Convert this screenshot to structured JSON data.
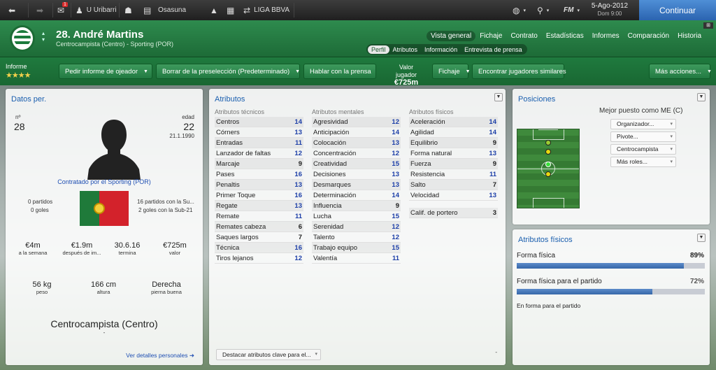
{
  "topbar": {
    "manager": "U Uribarri",
    "club": "Osasuna",
    "league": "LIGA BBVA",
    "notif_count": "1",
    "fm": "FM",
    "date": "5-Ago-2012",
    "day": "Dom 9:00",
    "continue": "Continuar"
  },
  "header": {
    "player_name": "28. André Martins",
    "player_sub": "Centrocampista (Centro) - Sporting (POR)",
    "tabs": [
      "Vista general",
      "Fichaje",
      "Contrato",
      "Estadísticas",
      "Informes",
      "Comparación",
      "Historia"
    ],
    "subtabs": [
      "Perfil",
      "Atributos",
      "Información",
      "Entrevista de prensa"
    ]
  },
  "actions": {
    "informe": "Informe",
    "stars": "★★★★",
    "scout": "Pedir informe de ojeador",
    "shortlist": "Borrar de la preselección (Predeterminado)",
    "press": "Hablar con la prensa",
    "value_label": "Valor jugador",
    "value": "€725m",
    "fichaje": "Fichaje",
    "similar": "Encontrar jugadores similares",
    "more": "Más acciones..."
  },
  "personal": {
    "title": "Datos per.",
    "num_label": "nº",
    "num": "28",
    "age_label": "edad",
    "age": "22",
    "dob": "21.1.1990",
    "contracted": "Contratado por el Sporting (POR)",
    "caps_left": "0 partidos",
    "goals_left": "0 goles",
    "caps_right": "16 partidos con la Su...",
    "goals_right": "2 goles con la Sub-21",
    "wage": "€4m",
    "wage_label": "a la semana",
    "bonus": "€1.9m",
    "bonus_label": "después de im...",
    "expiry": "30.6.16",
    "expiry_label": "termina",
    "value": "€725m",
    "value_label": "valor",
    "weight": "56 kg",
    "weight_label": "peso",
    "height": "166 cm",
    "height_label": "altura",
    "foot": "Derecha",
    "foot_label": "pierna buena",
    "position": "Centrocampista (Centro)",
    "dash": "-",
    "details_link": "Ver detalles personales ➜"
  },
  "attributes": {
    "title": "Atributos",
    "tech_header": "Atributos técnicos",
    "mental_header": "Atributos mentales",
    "phys_header": "Atributos físicos",
    "technical": [
      {
        "name": "Centros",
        "val": "14",
        "blue": true
      },
      {
        "name": "Córners",
        "val": "13",
        "blue": true
      },
      {
        "name": "Entradas",
        "val": "11",
        "blue": true
      },
      {
        "name": "Lanzador de faltas",
        "val": "12",
        "blue": true
      },
      {
        "name": "Marcaje",
        "val": "9",
        "blue": false
      },
      {
        "name": "Pases",
        "val": "16",
        "blue": true
      },
      {
        "name": "Penaltis",
        "val": "13",
        "blue": true
      },
      {
        "name": "Primer Toque",
        "val": "16",
        "blue": true
      },
      {
        "name": "Regate",
        "val": "13",
        "blue": true
      },
      {
        "name": "Remate",
        "val": "11",
        "blue": true
      },
      {
        "name": "Remates cabeza",
        "val": "6",
        "blue": false
      },
      {
        "name": "Saques largos",
        "val": "7",
        "blue": false
      },
      {
        "name": "Técnica",
        "val": "16",
        "blue": true
      },
      {
        "name": "Tiros lejanos",
        "val": "12",
        "blue": true
      }
    ],
    "mental": [
      {
        "name": "Agresividad",
        "val": "12",
        "blue": true
      },
      {
        "name": "Anticipación",
        "val": "14",
        "blue": true
      },
      {
        "name": "Colocación",
        "val": "13",
        "blue": true
      },
      {
        "name": "Concentración",
        "val": "12",
        "blue": true
      },
      {
        "name": "Creatividad",
        "val": "15",
        "blue": true
      },
      {
        "name": "Decisiones",
        "val": "13",
        "blue": true
      },
      {
        "name": "Desmarques",
        "val": "13",
        "blue": true
      },
      {
        "name": "Determinación",
        "val": "14",
        "blue": true
      },
      {
        "name": "Influencia",
        "val": "9",
        "blue": false
      },
      {
        "name": "Lucha",
        "val": "15",
        "blue": true
      },
      {
        "name": "Serenidad",
        "val": "12",
        "blue": true
      },
      {
        "name": "Talento",
        "val": "12",
        "blue": true
      },
      {
        "name": "Trabajo equipo",
        "val": "15",
        "blue": true
      },
      {
        "name": "Valentía",
        "val": "11",
        "blue": true
      }
    ],
    "physical": [
      {
        "name": "Aceleración",
        "val": "14",
        "blue": true
      },
      {
        "name": "Agilidad",
        "val": "14",
        "blue": true
      },
      {
        "name": "Equilibrio",
        "val": "9",
        "blue": false
      },
      {
        "name": "Forma natural",
        "val": "13",
        "blue": true
      },
      {
        "name": "Fuerza",
        "val": "9",
        "blue": false
      },
      {
        "name": "Resistencia",
        "val": "11",
        "blue": true
      },
      {
        "name": "Salto",
        "val": "7",
        "blue": false
      },
      {
        "name": "Velocidad",
        "val": "13",
        "blue": true
      }
    ],
    "goalkeeping": {
      "name": "Calif. de portero",
      "val": "3"
    },
    "highlight_button": "Destacar atributos clave para el...",
    "dash": "-"
  },
  "positions": {
    "title": "Posiciones",
    "best_label": "Mejor puesto como ME (C)",
    "roles": [
      "Organizador...",
      "Pivote...",
      "Centrocampista",
      "Más roles..."
    ]
  },
  "physical_panel": {
    "title": "Atributos físicos",
    "condition_label": "Forma física",
    "condition": "89%",
    "condition_value": 0.89,
    "match_label": "Forma física para el partido",
    "match": "72%",
    "match_value": 0.72,
    "status": "En forma para el partido"
  }
}
